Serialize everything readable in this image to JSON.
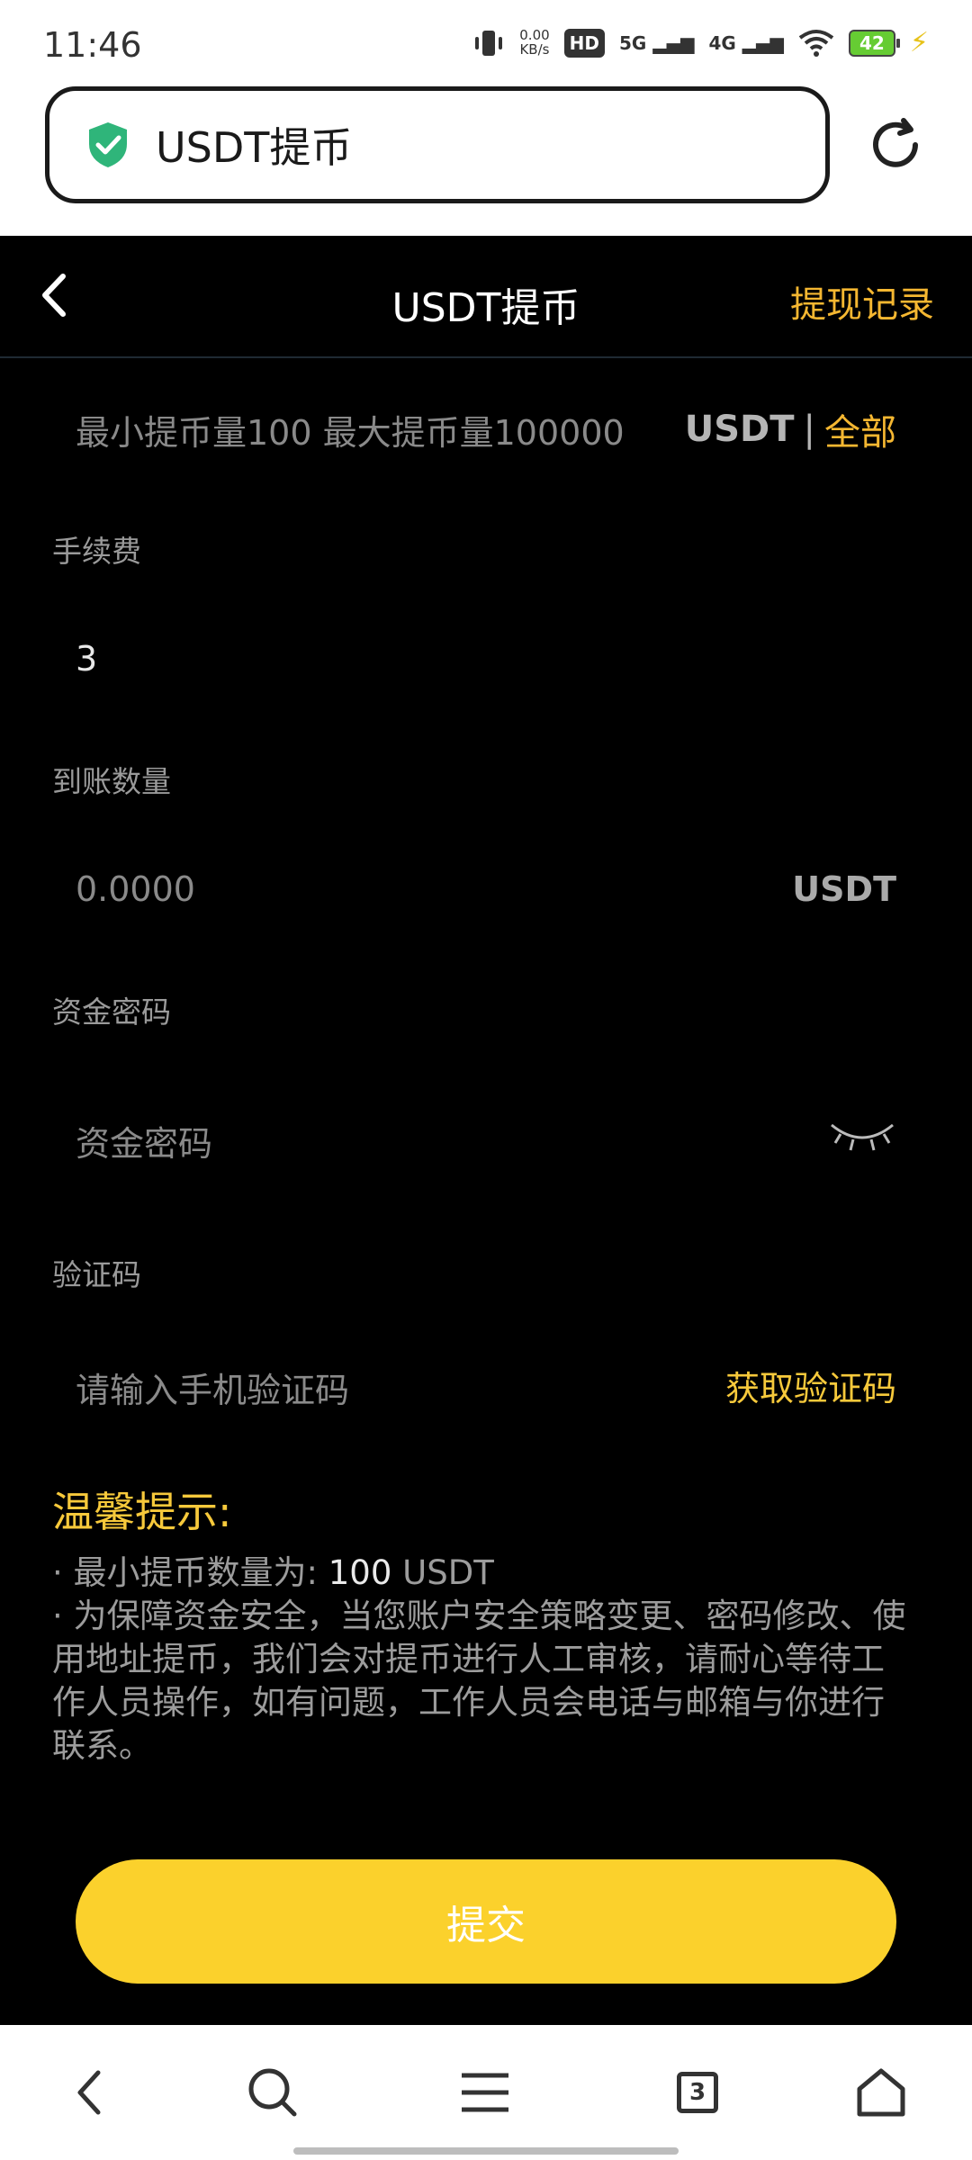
{
  "status_bar": {
    "time": "11:46",
    "net_speed_value": "0.00",
    "net_speed_unit": "KB/s",
    "hd": "HD",
    "sim1": "5G",
    "sim2": "4G",
    "battery": "42"
  },
  "browser": {
    "url_title": "USDT提币",
    "tab_count": "3"
  },
  "header": {
    "title": "USDT提币",
    "history_link": "提现记录"
  },
  "form": {
    "amount_placeholder": "最小提币量100 最大提币量100000",
    "amount_unit": "USDT",
    "amount_separator": "|",
    "amount_all": "全部",
    "fee_label": "手续费",
    "fee_value": "3",
    "received_label": "到账数量",
    "received_value": "0.0000",
    "received_unit": "USDT",
    "fund_password_label": "资金密码",
    "fund_password_placeholder": "资金密码",
    "code_label": "验证码",
    "code_placeholder": "请输入手机验证码",
    "get_code": "获取验证码"
  },
  "tips": {
    "title": "温馨提示:",
    "line1_prefix": "· 最小提币数量为:",
    "line1_amount": "100",
    "line1_unit": "USDT",
    "line2": "· 为保障资金安全，当您账户安全策略变更、密码修改、使用地址提币，我们会对提币进行人工审核，请耐心等待工作人员操作，如有问题，工作人员会电话与邮箱与你进行联系。"
  },
  "submit": {
    "label": "提交"
  },
  "colors": {
    "accent": "#f5b731",
    "submit_bg": "#fbd12c",
    "page_bg": "#000000"
  }
}
